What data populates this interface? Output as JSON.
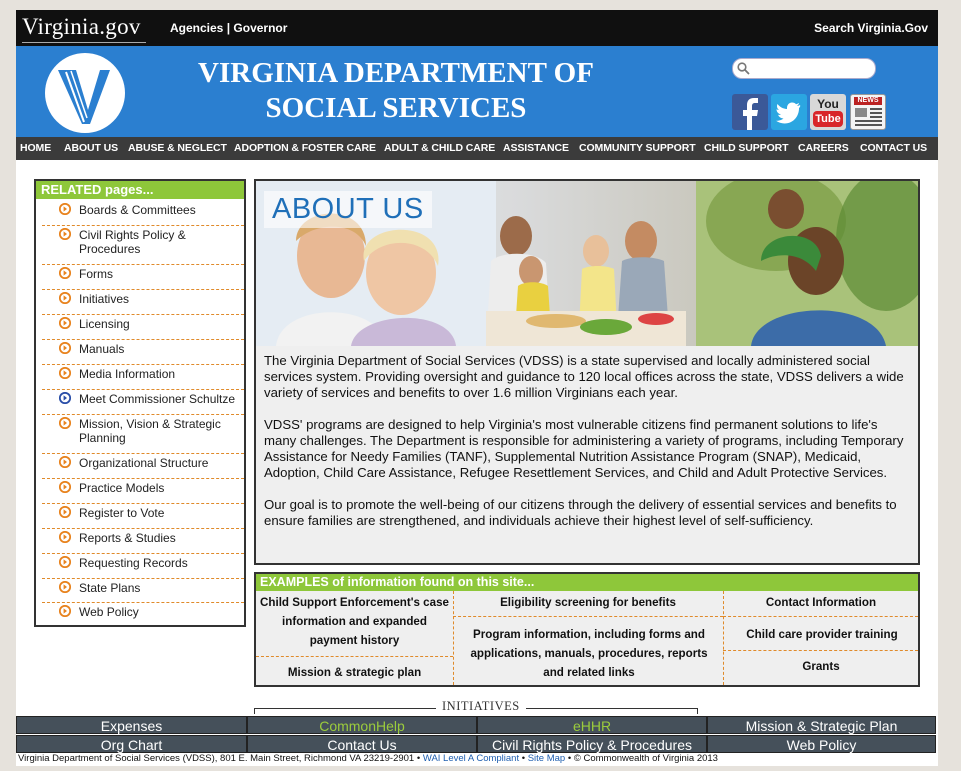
{
  "topbar": {
    "logo": "Virginia.gov",
    "agencies": "Agencies",
    "separator": "|",
    "governor": "Governor",
    "search_label": "Search Virginia.Gov"
  },
  "header": {
    "title_line1": "VIRGINIA DEPARTMENT OF",
    "title_line2": "SOCIAL SERVICES",
    "search_placeholder": "",
    "social": [
      "facebook-icon",
      "twitter-icon",
      "youtube-icon",
      "news-icon"
    ],
    "youtube_top": "You",
    "youtube_bottom": "Tube",
    "news_label": "NEWS"
  },
  "nav": [
    "HOME",
    "ABOUT US",
    "ABUSE & NEGLECT",
    "ADOPTION & FOSTER CARE",
    "ADULT & CHILD CARE",
    "ASSISTANCE",
    "COMMUNITY SUPPORT",
    "CHILD SUPPORT",
    "CAREERS",
    "CONTACT US"
  ],
  "sidebar": {
    "title": "RELATED pages...",
    "items": [
      {
        "label": "Boards & Committees",
        "icon": "orange-arrow-icon"
      },
      {
        "label": "Civil Rights Policy & Procedures",
        "icon": "orange-arrow-icon"
      },
      {
        "label": "Forms",
        "icon": "orange-arrow-icon"
      },
      {
        "label": "Initiatives",
        "icon": "orange-arrow-icon"
      },
      {
        "label": "Licensing",
        "icon": "orange-arrow-icon"
      },
      {
        "label": "Manuals",
        "icon": "orange-arrow-icon"
      },
      {
        "label": "Media Information",
        "icon": "orange-arrow-icon"
      },
      {
        "label": "Meet Commissioner Schultze",
        "icon": "blue-arrow-icon"
      },
      {
        "label": "Mission, Vision & Strategic Planning",
        "icon": "orange-arrow-icon"
      },
      {
        "label": "Organizational Structure",
        "icon": "orange-arrow-icon"
      },
      {
        "label": "Practice Models",
        "icon": "orange-arrow-icon"
      },
      {
        "label": "Register to Vote",
        "icon": "orange-arrow-icon"
      },
      {
        "label": "Reports & Studies",
        "icon": "orange-arrow-icon"
      },
      {
        "label": "Requesting Records",
        "icon": "orange-arrow-icon"
      },
      {
        "label": "State Plans",
        "icon": "orange-arrow-icon"
      },
      {
        "label": "Web Policy",
        "icon": "orange-arrow-icon"
      }
    ]
  },
  "about": {
    "banner_title": "ABOUT US",
    "p1": "The Virginia Department of Social Services (VDSS) is a state supervised and locally administered social services system. Providing oversight and guidance to 120 local offices across the state, VDSS delivers a wide variety of services and benefits to over 1.6 million Virginians each year.",
    "p2": "VDSS' programs are designed to help Virginia's most vulnerable citizens find permanent solutions to life's many challenges. The Department is responsible for administering a variety of programs, including Temporary Assistance for Needy Families (TANF), Supplemental Nutrition Assistance Program (SNAP), Medicaid, Adoption, Child Care Assistance, Refugee Resettlement Services, and Child and Adult Protective Services.",
    "p3": "Our goal is to promote the well-being of our citizens through the delivery of essential services and benefits to ensure families are strengthened, and individuals achieve their highest level of self-sufficiency."
  },
  "examples": {
    "title": "EXAMPLES of information found on this site...",
    "child_support": "Child Support Enforcement's case information and expanded payment history",
    "eligibility": "Eligibility screening for benefits",
    "contact": "Contact Information",
    "program_info": "Program information, including forms and applications, manuals, procedures, reports and related links",
    "provider_training": "Child care provider training",
    "mission": "Mission & strategic plan",
    "grants": "Grants"
  },
  "initiatives": {
    "label": "INITIATIVES",
    "row1": [
      "Expenses",
      "CommonHelp",
      "eHHR",
      "Mission & Strategic Plan"
    ],
    "row2": [
      "Org Chart",
      "Contact Us",
      "Civil Rights Policy & Procedures",
      "Web Policy"
    ]
  },
  "footer": {
    "address": "Virginia Department of Social Services (VDSS), 801 E. Main Street, Richmond VA 23219-2901",
    "sep": "•",
    "wai": "WAI Level A Compliant",
    "sitemap": "Site Map",
    "copyright": "© Commonwealth of Virginia 2013"
  },
  "colors": {
    "header_blue": "#2b7fd0",
    "nav_gray": "#3b3b3b",
    "accent_green": "#8ec73a",
    "arrow_orange": "#e8831e",
    "arrow_blue": "#2a4ea8"
  }
}
